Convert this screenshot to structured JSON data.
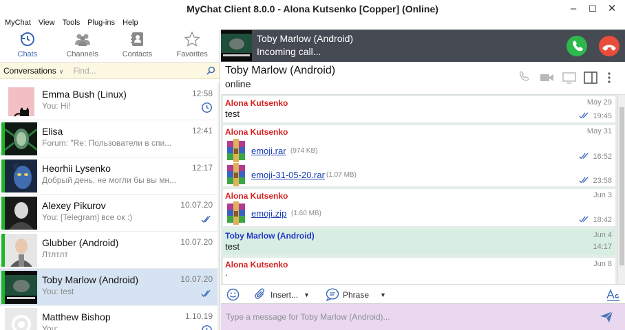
{
  "window": {
    "title": "MyChat Client 8.0.0 - Alona Kutsenko [Copper] (Online)"
  },
  "menu": [
    "MyChat",
    "View",
    "Tools",
    "Plug-ins",
    "Help"
  ],
  "nav": {
    "tabs": [
      {
        "label": "Chats",
        "icon": "clock-icon",
        "active": true
      },
      {
        "label": "Channels",
        "icon": "users-icon",
        "active": false
      },
      {
        "label": "Contacts",
        "icon": "address-book-icon",
        "active": false
      },
      {
        "label": "Favorites",
        "icon": "star-icon",
        "active": false
      }
    ]
  },
  "conversations": {
    "filter_label": "Conversations",
    "search_placeholder": "Find...",
    "items": [
      {
        "name": "Emma Bush (Linux)",
        "preview": "You: Hi!",
        "time": "12:58",
        "status_icon": "clock-icon",
        "bar": "#ffffff"
      },
      {
        "name": "Elisa",
        "preview": "Forum: \"Re: Пользователи в спи...",
        "time": "12:41",
        "status_icon": "",
        "bar": "#1fb52a"
      },
      {
        "name": "Heorhii Lysenko",
        "preview": "Добрый день, не могли бы вы мн...",
        "time": "12:17",
        "status_icon": "",
        "bar": "#1fb52a"
      },
      {
        "name": "Alexey Pikurov",
        "preview": "You: [Telegram] все ок :)",
        "time": "10.07.20",
        "status_icon": "double-check-icon",
        "bar": "#1fb52a"
      },
      {
        "name": "Glubber (Android)",
        "preview": "Лтлтлт",
        "time": "10.07.20",
        "status_icon": "",
        "bar": "#1fb52a"
      },
      {
        "name": "Toby Marlow (Android)",
        "preview": "You: test",
        "time": "10.07.20",
        "status_icon": "double-check-icon",
        "bar": "#1fb52a"
      },
      {
        "name": "Matthew Bishop",
        "preview": "You:",
        "time": "1.10.19",
        "status_icon": "clock-icon",
        "bar": "#ffffff"
      }
    ]
  },
  "call": {
    "name": "Toby Marlow (Android)",
    "status": "Incoming call...",
    "accept_color": "#2db84d",
    "decline_color": "#e84c3d"
  },
  "chat": {
    "name": "Toby Marlow (Android)",
    "status": "online",
    "messages": [
      {
        "author": "Alona Kutsenko",
        "date": "May 29",
        "text": "test",
        "time": "19:45"
      },
      {
        "author": "Alona Kutsenko",
        "date": "May 31",
        "files": [
          {
            "name": "emoji.rar",
            "size": "(974 KB)",
            "time": "16:52"
          },
          {
            "name": "emoji-31-05-20.rar",
            "size": "(1.07 MB)",
            "time": "23:58"
          }
        ]
      },
      {
        "author": "Alona Kutsenko",
        "date": "Jun 3",
        "files": [
          {
            "name": "emoji.zip",
            "size": "(1.60 MB)",
            "time": "18:42"
          }
        ]
      },
      {
        "author": "Toby Marlow (Android)",
        "date": "Jun 4",
        "text": "test",
        "time": "14:17"
      },
      {
        "author": "Alona Kutsenko",
        "date": "Jun 8",
        "text": "."
      }
    ]
  },
  "toolbar": {
    "insert_label": "Insert...",
    "phrase_label": "Phrase"
  },
  "composer": {
    "placeholder": "Type a message for Toby Marlow (Android)..."
  }
}
